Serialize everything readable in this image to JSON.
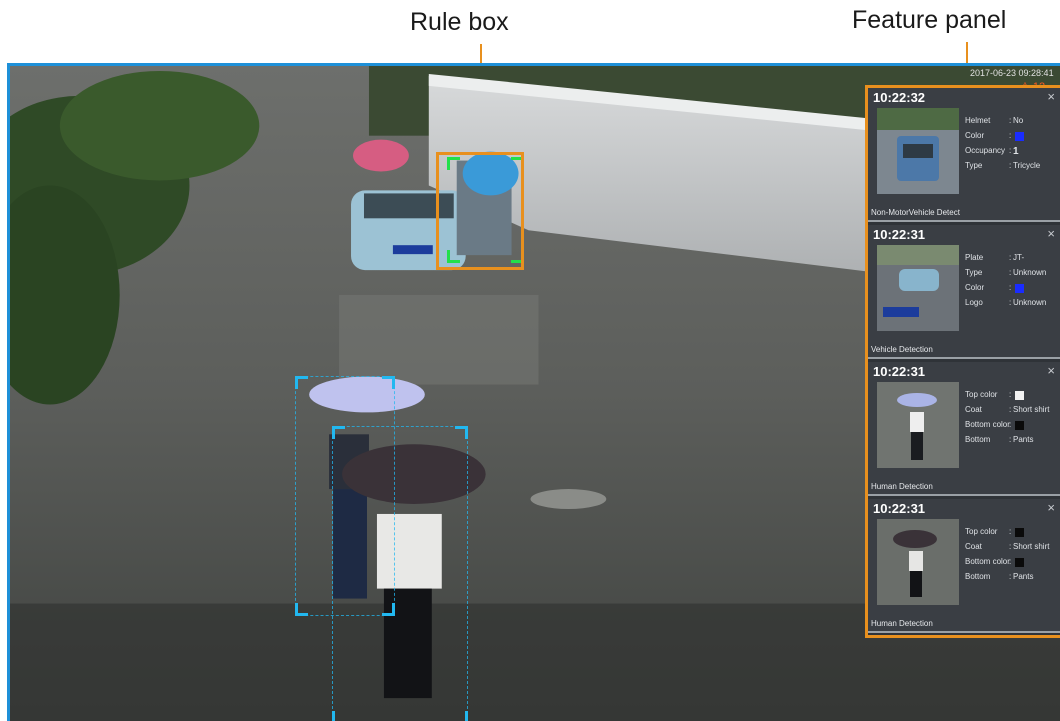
{
  "annotations": {
    "rule_box_label": "Rule box",
    "feature_panel_label": "Feature panel"
  },
  "osd": {
    "timestamp": "2017-06-23 09:28:41",
    "alert": "⚠ 12"
  },
  "colors": {
    "callout": "#e8901e",
    "frame": "#1e90d8",
    "non_motor_box": "#22e04a",
    "human_box": "#22b8f0",
    "panel_bg": "#2f3338"
  },
  "cards": [
    {
      "time": "10:22:32",
      "close": "×",
      "type": "Non-MotorVehicle Detect",
      "attrs": [
        {
          "key": "Helmet",
          "sep": ":",
          "value": "No"
        },
        {
          "key": "Color",
          "sep": ":",
          "swatch": "#1a2cff"
        },
        {
          "key": "Occupancy",
          "sep": ":",
          "value": "1"
        },
        {
          "key": "Type",
          "sep": ":",
          "value": "Tricycle"
        }
      ]
    },
    {
      "time": "10:22:31",
      "close": "×",
      "type": "Vehicle Detection",
      "attrs": [
        {
          "key": "Plate",
          "sep": ":",
          "value": "JT-"
        },
        {
          "key": "Type",
          "sep": ":",
          "value": "Unknown"
        },
        {
          "key": "Color",
          "sep": ":",
          "swatch": "#1a2cff"
        },
        {
          "key": "Logo",
          "sep": ":",
          "value": "Unknown"
        }
      ]
    },
    {
      "time": "10:22:31",
      "close": "×",
      "type": "Human Detection",
      "attrs": [
        {
          "key": "Top color",
          "sep": ":",
          "swatch": "#f2f2f2"
        },
        {
          "key": "Coat",
          "sep": ":",
          "value": "Short shirt"
        },
        {
          "key": "Bottom color",
          "sep": ":",
          "swatch": "#0a0a0a"
        },
        {
          "key": "Bottom",
          "sep": ":",
          "value": "Pants"
        }
      ]
    },
    {
      "time": "10:22:31",
      "close": "×",
      "type": "Human Detection",
      "attrs": [
        {
          "key": "Top color",
          "sep": ":",
          "swatch": "#0a0a0a"
        },
        {
          "key": "Coat",
          "sep": ":",
          "value": "Short shirt"
        },
        {
          "key": "Bottom color",
          "sep": ":",
          "swatch": "#0a0a0a"
        },
        {
          "key": "Bottom",
          "sep": ":",
          "value": "Pants"
        }
      ]
    }
  ]
}
